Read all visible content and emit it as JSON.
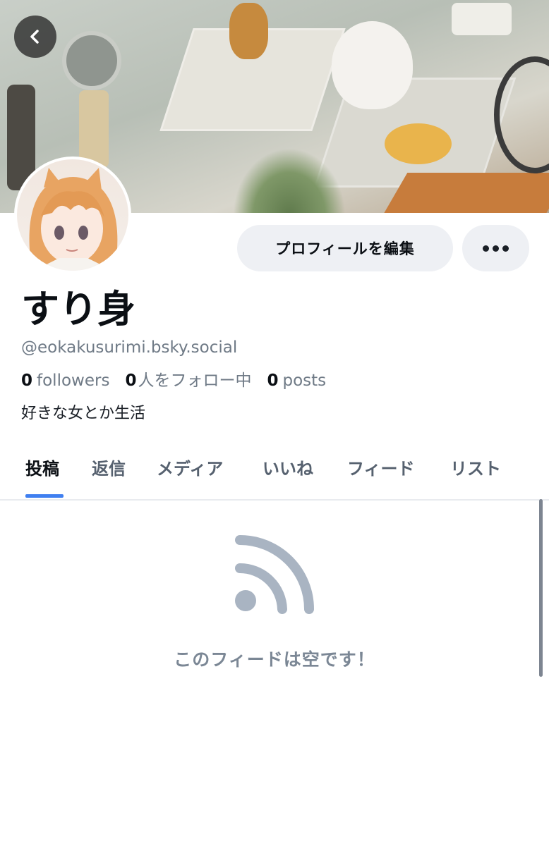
{
  "profile": {
    "display_name": "すり身",
    "handle": "@eokakusurimi.bsky.social",
    "bio": "好きな女とか生活",
    "stats": {
      "followers_count": "0",
      "followers_label": "followers",
      "following_count": "0",
      "following_label": "人をフォロー中",
      "posts_count": "0",
      "posts_label": "posts"
    }
  },
  "actions": {
    "edit_label": "プロフィールを編集",
    "more_icon": "more-horizontal-icon",
    "back_icon": "chevron-left-icon"
  },
  "tabs": [
    {
      "label": "投稿",
      "active": true
    },
    {
      "label": "返信",
      "active": false
    },
    {
      "label": "メディア",
      "active": false
    },
    {
      "label": "いいね",
      "active": false
    },
    {
      "label": "フィード",
      "active": false
    },
    {
      "label": "リスト",
      "active": false
    }
  ],
  "feed": {
    "empty_icon": "rss-feed-icon",
    "empty_message": "このフィードは空です！"
  },
  "colors": {
    "accent": "#3f7ff0",
    "muted_text": "#6f7a86",
    "button_bg": "#eef0f4",
    "empty_icon": "#a9b4c2"
  }
}
